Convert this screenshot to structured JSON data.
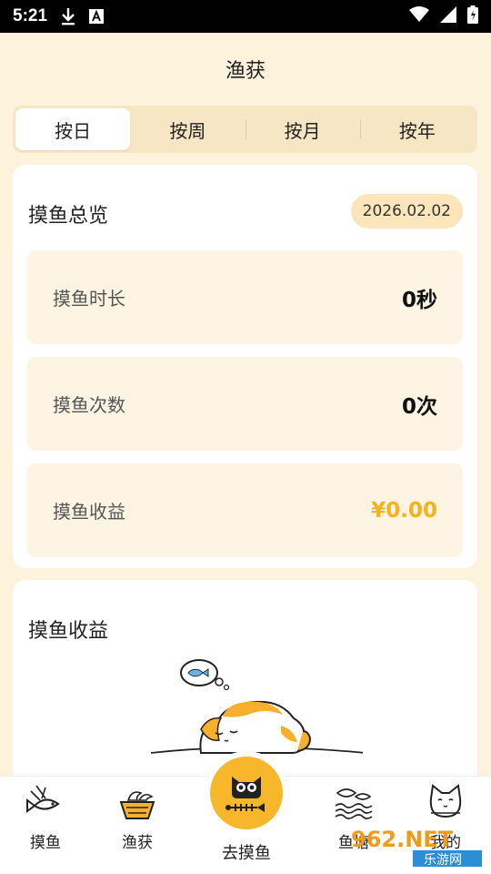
{
  "status_bar": {
    "time": "5:21"
  },
  "header": {
    "title": "渔获"
  },
  "tabs": [
    {
      "label": "按日",
      "active": true
    },
    {
      "label": "按周",
      "active": false
    },
    {
      "label": "按月",
      "active": false
    },
    {
      "label": "按年",
      "active": false
    }
  ],
  "overview": {
    "title": "摸鱼总览",
    "date": "2026.02.02",
    "stats": [
      {
        "label": "摸鱼时长",
        "value": "0秒"
      },
      {
        "label": "摸鱼次数",
        "value": "0次"
      },
      {
        "label": "摸鱼收益",
        "value": "¥0.00"
      }
    ]
  },
  "earnings": {
    "title": "摸鱼收益"
  },
  "bottom_nav": [
    {
      "label": "摸鱼",
      "icon": "fish-icon"
    },
    {
      "label": "渔获",
      "icon": "fish-basket-icon"
    },
    {
      "label": "去摸鱼",
      "icon": "cat-fishbone-icon"
    },
    {
      "label": "鱼塘",
      "icon": "fish-pond-icon"
    },
    {
      "label": "我的",
      "icon": "cat-avatar-icon"
    }
  ],
  "watermark": {
    "text_top": "962.NET",
    "text_bottom": "乐游网"
  },
  "colors": {
    "background": "#fdf2dc",
    "accent": "#f8b62a",
    "money": "#f5b21e"
  }
}
